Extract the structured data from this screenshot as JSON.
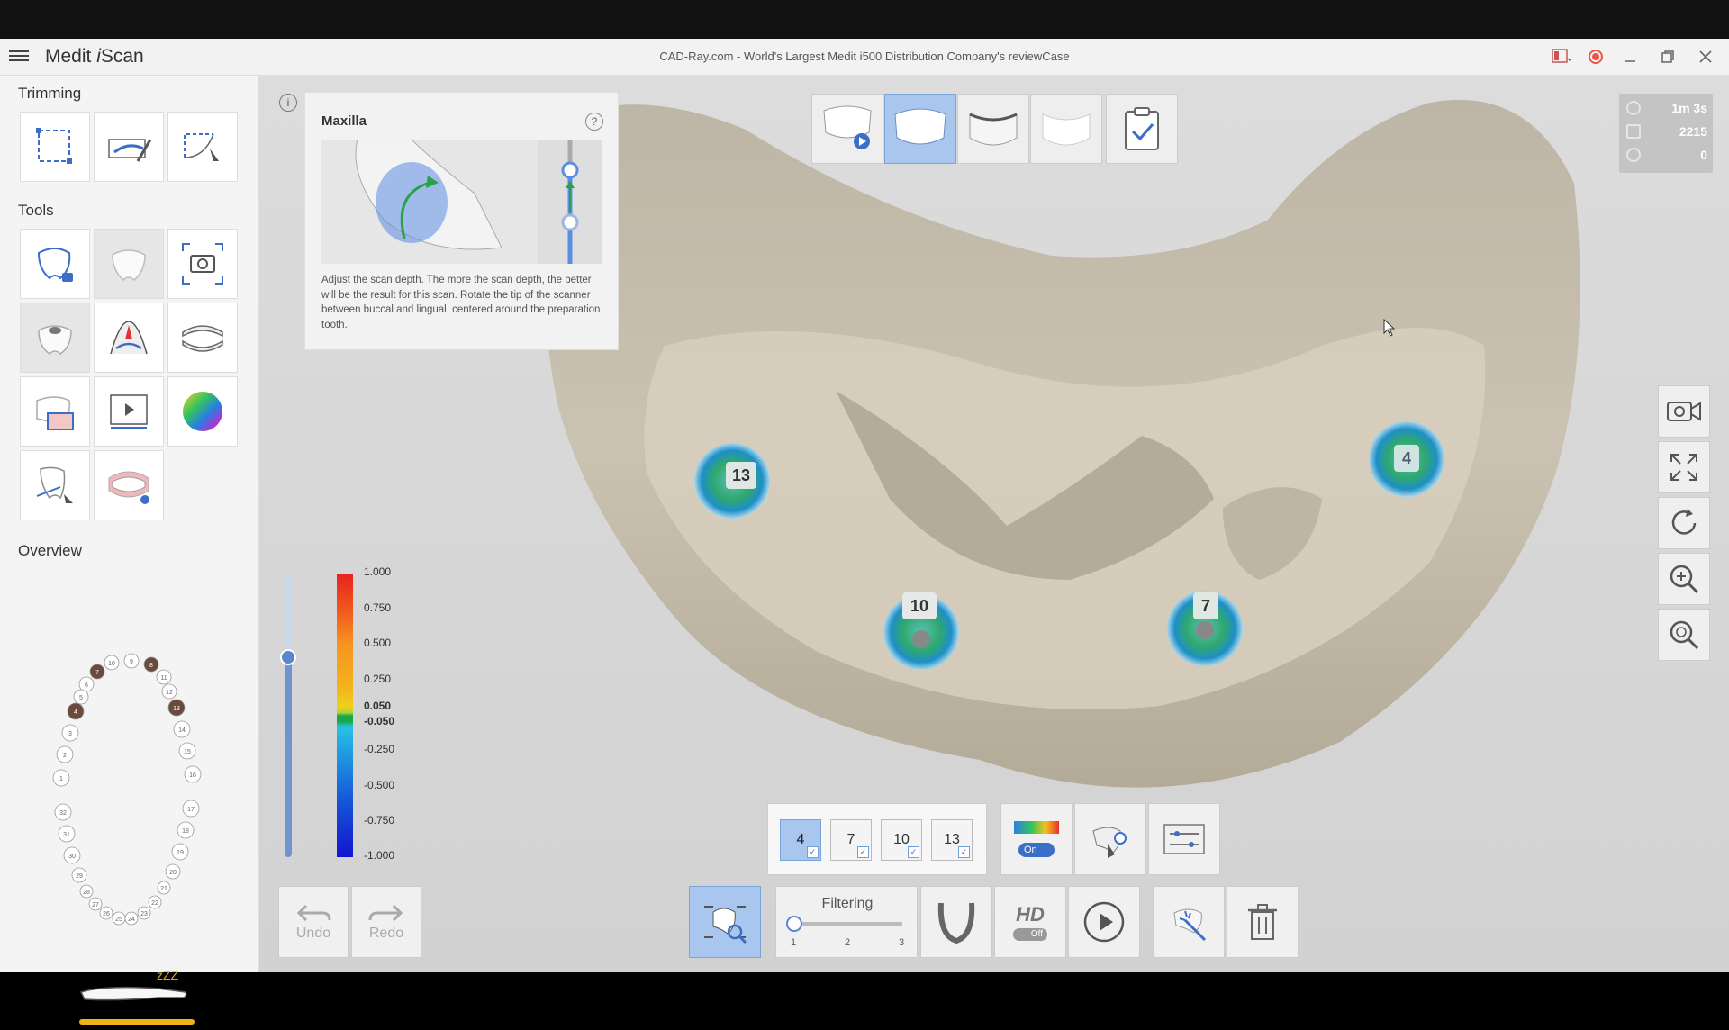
{
  "window": {
    "app_name_prefix": "Medit ",
    "app_name_italic": "i",
    "app_name_suffix": "Scan",
    "caption": "CAD-Ray.com - World's Largest Medit i500 Distribution Company's reviewCase"
  },
  "sidebar": {
    "trimming_title": "Trimming",
    "tools_title": "Tools",
    "overview_title": "Overview"
  },
  "tip": {
    "title": "Maxilla",
    "help": "?",
    "info": "i",
    "text": "Adjust the scan depth. The more the scan depth, the better will be the result for this scan. Rotate the tip of the scanner between buccal and lingual, centered around the preparation tooth."
  },
  "stats": {
    "time": "1m 3s",
    "frames": "2215",
    "third": "0"
  },
  "colorbar": {
    "labels": [
      "1.000",
      "0.750",
      "0.500",
      "0.250",
      "0.050",
      "-0.050",
      "-0.250",
      "-0.500",
      "-0.750",
      "-1.000"
    ]
  },
  "implants": [
    {
      "label": "13"
    },
    {
      "label": "10"
    },
    {
      "label": "7"
    },
    {
      "label": "4"
    }
  ],
  "tooth_selector": [
    "4",
    "7",
    "10",
    "13"
  ],
  "toggle_label": "On",
  "hd_label": "HD",
  "hd_toggle": "Off",
  "undo_label": "Undo",
  "redo_label": "Redo",
  "filtering": {
    "title": "Filtering",
    "marks": [
      "1",
      "2",
      "3"
    ]
  },
  "scanner_sleep": "zZZ",
  "overview_numbers": [
    "10",
    "9",
    "8",
    "7",
    "11",
    "6",
    "12",
    "5",
    "13",
    "4",
    "14",
    "3",
    "15",
    "2",
    "16",
    "1",
    "32",
    "17",
    "31",
    "18",
    "30",
    "19",
    "29",
    "20",
    "28",
    "21",
    "27",
    "22",
    "26",
    "23",
    "25",
    "24"
  ]
}
